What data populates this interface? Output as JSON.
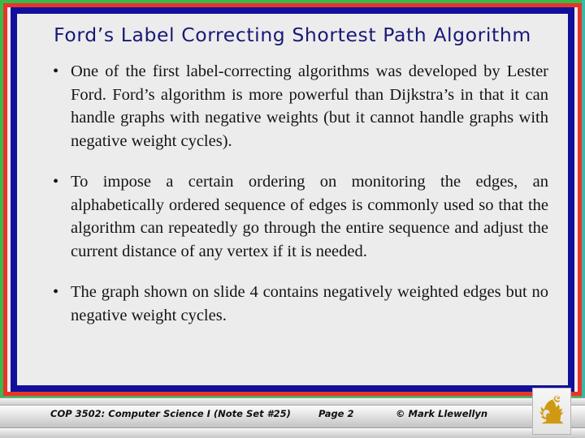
{
  "slide": {
    "title": "Ford’s Label Correcting Shortest Path Algorithm",
    "bullet_marker": "•",
    "bullets": [
      "One of the first label-correcting algorithms was developed by Lester Ford.  Ford’s algorithm is more powerful than Dijkstra’s in that it can handle graphs with negative weights (but it cannot handle graphs with negative weight cycles).",
      "To impose a certain ordering on monitoring the edges, an alphabetically ordered sequence of edges is commonly used so that the algorithm can repeatedly go through the entire sequence and adjust the current distance of any vertex if it is needed.",
      "The graph shown on slide 4 contains negatively weighted edges but no negative weight cycles."
    ]
  },
  "footer": {
    "course": "COP 3502: Computer Science I  (Note Set #25)",
    "page": "Page 2",
    "copyright": "© Mark Llewellyn",
    "logo_name": "ucf-pegasus-logo"
  },
  "colors": {
    "frame_green": "#3cb84a",
    "frame_red": "#e8342a",
    "frame_navy": "#120f9c",
    "frame_teal": "#3cb8a8",
    "slide_background": "#ececec",
    "title_text": "#181878",
    "body_text": "#141414",
    "logo_gold": "#cf9a12"
  }
}
